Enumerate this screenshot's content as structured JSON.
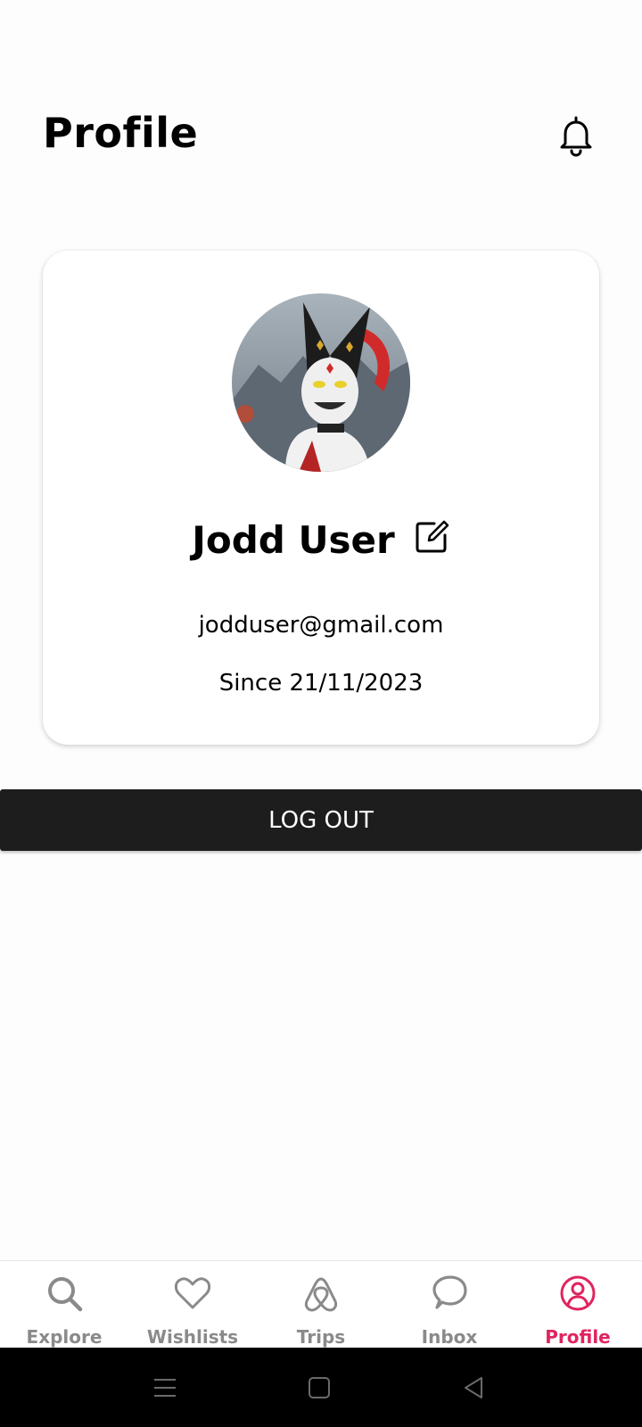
{
  "header": {
    "title": "Profile",
    "notification_icon": "bell-icon"
  },
  "profile": {
    "name": "Jodd User",
    "edit_icon": "edit-icon",
    "email": "jodduser@gmail.com",
    "since": "Since 21/11/2023",
    "avatar": "jester-avatar-photo"
  },
  "actions": {
    "logout_label": "LOG OUT"
  },
  "tabs": [
    {
      "label": "Explore",
      "icon": "search-icon"
    },
    {
      "label": "Wishlists",
      "icon": "heart-icon"
    },
    {
      "label": "Trips",
      "icon": "airbnb-logo-icon"
    },
    {
      "label": "Inbox",
      "icon": "chat-bubble-icon"
    },
    {
      "label": "Profile",
      "icon": "user-circle-icon",
      "active": true
    }
  ],
  "colors": {
    "accent": "#e0245e",
    "inactive": "#8a8a8a",
    "logout_bg": "#1d1d1d"
  },
  "system_nav": [
    "menu-icon",
    "home-square-icon",
    "back-triangle-icon"
  ]
}
